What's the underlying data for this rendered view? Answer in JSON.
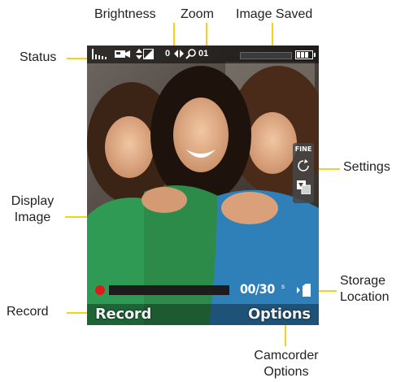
{
  "callouts": {
    "brightness": "Brightness",
    "zoom": "Zoom",
    "image_saved": "Image Saved",
    "status": "Status",
    "settings": "Settings",
    "display_image_line1": "Display",
    "display_image_line2": "Image",
    "storage_location_line1": "Storage",
    "storage_location_line2": "Location",
    "record": "Record",
    "camcorder_options_line1": "Camcorder",
    "camcorder_options_line2": "Options"
  },
  "screen": {
    "status": {
      "brightness_value": "0",
      "zoom_value": "01"
    },
    "settings_panel": {
      "quality": "FINE",
      "icons": [
        "self-timer-icon",
        "white-balance-icon"
      ]
    },
    "recording": {
      "timer": "00/30",
      "timer_unit": "s",
      "progress": 0.0
    },
    "softkeys": {
      "left": "Record",
      "right": "Options"
    }
  },
  "colors": {
    "leader": "#f2d21b",
    "record_dot": "#e01a1a"
  }
}
